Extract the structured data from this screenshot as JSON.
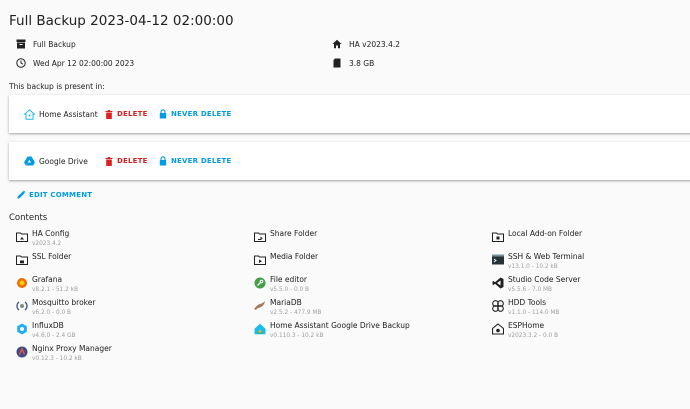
{
  "header": {
    "title": "Full Backup 2023-04-12 02:00:00"
  },
  "meta": {
    "type": "Full Backup",
    "date": "Wed Apr 12 02:00:00 2023",
    "ha_version": "HA v2023.4.2",
    "size": "3.8 GB"
  },
  "locations": {
    "label": "This backup is present in:",
    "items": [
      {
        "name": "Home Assistant",
        "delete": "DELETE",
        "never_delete": "NEVER DELETE"
      },
      {
        "name": "Google Drive",
        "delete": "DELETE",
        "never_delete": "NEVER DELETE"
      }
    ]
  },
  "edit_comment": "EDIT COMMENT",
  "contents": {
    "label": "Contents",
    "col1": [
      {
        "name": "HA Config",
        "version": "v2023.4.2",
        "icon": "folder-icon"
      },
      {
        "name": "SSL Folder",
        "version": "",
        "icon": "folder-lock-icon"
      },
      {
        "name": "Grafana",
        "version": "v8.2.1 - 51.2 kB",
        "icon": "grafana-icon"
      },
      {
        "name": "Mosquitto broker",
        "version": "v6.2.0 - 0.0 B",
        "icon": "mosquitto-icon"
      },
      {
        "name": "InfluxDB",
        "version": "v4.6.0 - 2.4 GB",
        "icon": "influxdb-icon"
      },
      {
        "name": "Nginx Proxy Manager",
        "version": "v0.12.3 - 10.2 kB",
        "icon": "nginx-icon"
      }
    ],
    "col2": [
      {
        "name": "Share Folder",
        "version": "",
        "icon": "folder-share-icon"
      },
      {
        "name": "Media Folder",
        "version": "",
        "icon": "folder-media-icon"
      },
      {
        "name": "File editor",
        "version": "v5.5.0 - 0.0 B",
        "icon": "wrench-icon"
      },
      {
        "name": "MariaDB",
        "version": "v2.5.2 - 477.9 MB",
        "icon": "mariadb-icon"
      },
      {
        "name": "Home Assistant Google Drive Backup",
        "version": "v0.110.3 - 10.2 kB",
        "icon": "gdrive-backup-icon"
      }
    ],
    "col3": [
      {
        "name": "Local Add-on Folder",
        "version": "",
        "icon": "folder-local-icon"
      },
      {
        "name": "SSH & Web Terminal",
        "version": "v13.1.0 - 10.2 kB",
        "icon": "terminal-icon"
      },
      {
        "name": "Studio Code Server",
        "version": "v5.5.6 - 7.0 MB",
        "icon": "vscode-icon"
      },
      {
        "name": "HDD Tools",
        "version": "v1.1.0 - 114.0 MB",
        "icon": "hdd-tools-icon"
      },
      {
        "name": "ESPHome",
        "version": "v2023.3.2 - 0.0 B",
        "icon": "esphome-icon"
      }
    ]
  },
  "colors": {
    "accent": "#039be5",
    "danger": "#db2121",
    "ha_blue": "#18bcf2"
  }
}
